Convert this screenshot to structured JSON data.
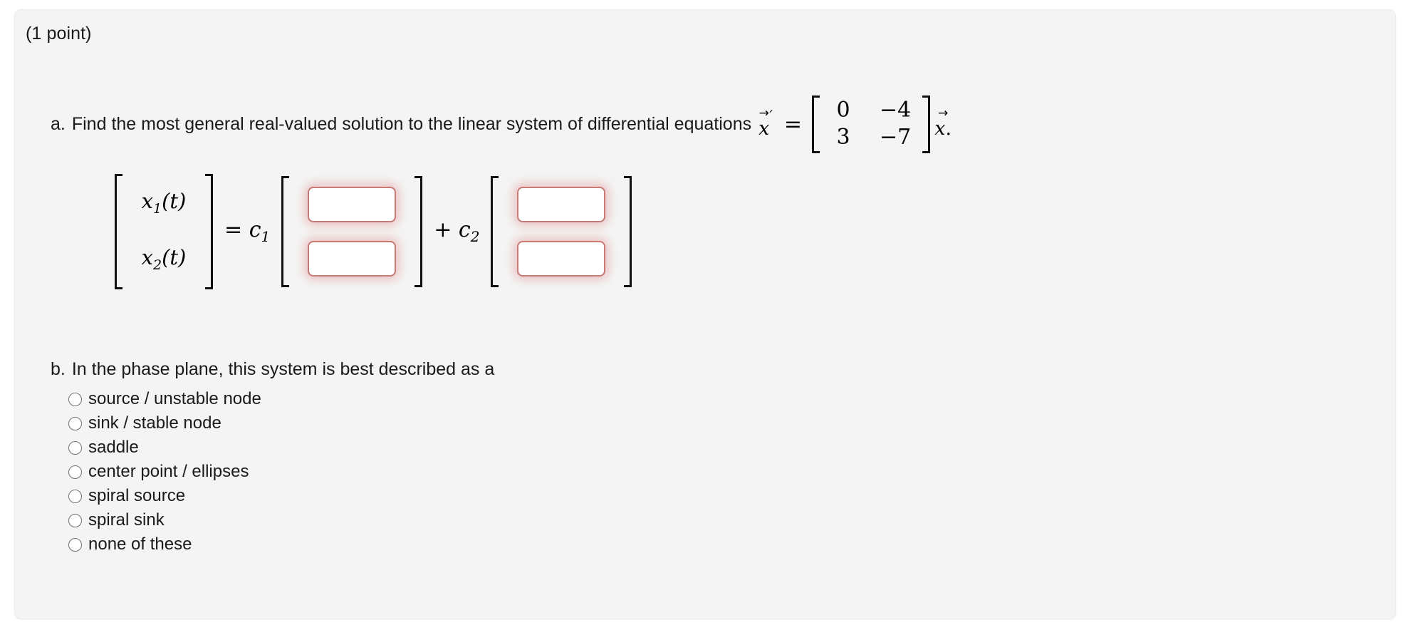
{
  "card": {
    "points_text": "(1 point)",
    "background_color": "#f4f4f4",
    "accent_color": "#d9534f"
  },
  "part_a": {
    "label": "a.",
    "prompt": "Find the most general real-valued solution to the linear system of differential equations",
    "equation": {
      "lhs_variable": "x",
      "lhs_prime": "′",
      "equals": "=",
      "matrix": {
        "rows": [
          [
            "0",
            "−4"
          ],
          [
            "3",
            "−7"
          ]
        ]
      },
      "rhs_variable": "x",
      "trailing_punctuation": "."
    },
    "solution": {
      "lhs_vector": [
        "x",
        "x"
      ],
      "lhs_vector_subscripts": [
        "1",
        "2"
      ],
      "lhs_vector_args": [
        "(t)",
        "(t)"
      ],
      "equals": "=",
      "coefficient_1": "c",
      "coefficient_1_sub": "1",
      "plus": "+",
      "coefficient_2": "c",
      "coefficient_2_sub": "2",
      "input_values": [
        "",
        "",
        "",
        ""
      ],
      "input_placeholders": [
        "",
        "",
        "",
        ""
      ]
    }
  },
  "part_b": {
    "label": "b.",
    "prompt": "In the phase plane, this system is best described as a",
    "options": [
      {
        "label": "source / unstable node",
        "selected": false
      },
      {
        "label": "sink / stable node",
        "selected": false
      },
      {
        "label": "saddle",
        "selected": false
      },
      {
        "label": "center point / ellipses",
        "selected": false
      },
      {
        "label": "spiral source",
        "selected": false
      },
      {
        "label": "spiral sink",
        "selected": false
      },
      {
        "label": "none of these",
        "selected": false
      }
    ]
  }
}
